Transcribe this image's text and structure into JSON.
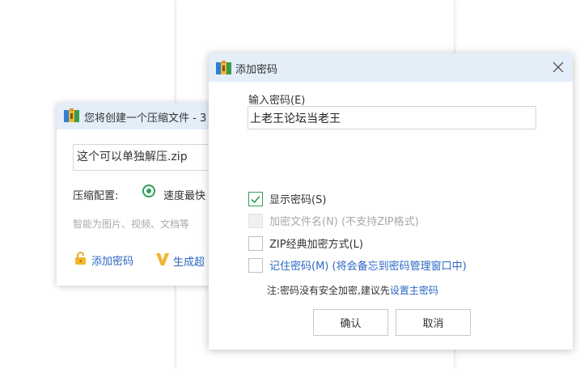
{
  "back_window": {
    "title": "您将创建一个压缩文件 - 3",
    "filename": "这个可以单独解压.zip",
    "config_label": "压缩配置:",
    "speed_option": "速度最快",
    "hint": "智能为图片、视频、文档等",
    "add_password_link": "添加密码",
    "generate_link": "生成超"
  },
  "dialog": {
    "title": "添加密码",
    "password_label": "输入密码(E)",
    "password_value": "上老王论坛当老王",
    "options": [
      {
        "label": "显示密码(S)",
        "checked": true,
        "disabled": false
      },
      {
        "label": "加密文件名(N) (不支持ZIP格式)",
        "checked": false,
        "disabled": true
      },
      {
        "label": "ZIP经典加密方式(L)",
        "checked": false,
        "disabled": false
      },
      {
        "label": "记住密码(M) (将会备忘到密码管理窗口中)",
        "checked": false,
        "disabled": false
      }
    ],
    "note_prefix": "注:密码没有安全加密,建议先",
    "note_link": "设置主密码",
    "ok_label": "确认",
    "cancel_label": "取消"
  },
  "colors": {
    "accent_green": "#2e9d57",
    "link_blue": "#2b67c4",
    "titlebar": "#e4eef9"
  },
  "icons": [
    "archive-app-icon",
    "close-icon",
    "lock-icon",
    "v-logo-icon",
    "check-icon"
  ]
}
